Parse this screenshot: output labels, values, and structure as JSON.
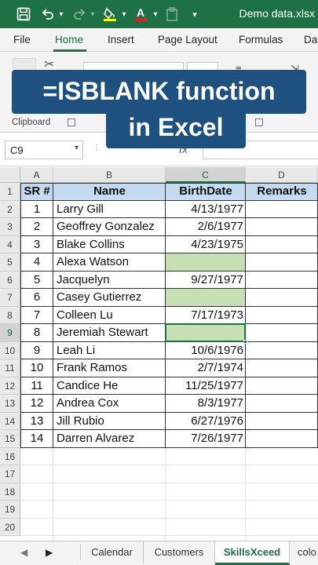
{
  "window": {
    "doc_title": "Demo data.xlsx",
    "qa_icons": [
      "save-icon",
      "undo-icon",
      "redo-icon",
      "fill-color-icon",
      "font-color-icon",
      "clipboard-icon",
      "customize-icon"
    ]
  },
  "ribbon": {
    "tabs": [
      {
        "label": "File",
        "active": false
      },
      {
        "label": "Home",
        "active": true
      },
      {
        "label": "Insert",
        "active": false
      },
      {
        "label": "Page Layout",
        "active": false
      },
      {
        "label": "Formulas",
        "active": false
      },
      {
        "label": "Da",
        "active": false
      }
    ],
    "clipboard_label": "Clipboard",
    "accent_color": "#1e7145"
  },
  "banner": {
    "line1": "=ISBLANK function",
    "line2": "in Excel",
    "bg_color": "#1f5180"
  },
  "formula_bar": {
    "name_box": "C9",
    "fx_label": "fx",
    "content": ""
  },
  "grid": {
    "columns": [
      "A",
      "B",
      "C",
      "D"
    ],
    "selected_column": "C",
    "row_numbers": [
      "1",
      "2",
      "3",
      "4",
      "5",
      "6",
      "7",
      "8",
      "9",
      "10",
      "11",
      "12",
      "13",
      "14",
      "15",
      "16",
      "17",
      "18",
      "19",
      "20"
    ],
    "selected_row": "9",
    "headers": [
      "SR #",
      "Name",
      "BirthDate",
      "Remarks"
    ],
    "header_fill": "#c5d9f1",
    "blank_fill": "#c6dfb4",
    "rows": [
      {
        "sr": "1",
        "name": "Larry Gill",
        "birth": "4/13/1977"
      },
      {
        "sr": "2",
        "name": "Geoffrey Gonzalez",
        "birth": "2/6/1977"
      },
      {
        "sr": "3",
        "name": "Blake Collins",
        "birth": "4/23/1975"
      },
      {
        "sr": "4",
        "name": "Alexa Watson",
        "birth": ""
      },
      {
        "sr": "5",
        "name": "Jacquelyn",
        "birth": "9/27/1977"
      },
      {
        "sr": "6",
        "name": "Casey Gutierrez",
        "birth": ""
      },
      {
        "sr": "7",
        "name": "Colleen Lu",
        "birth": "7/17/1973"
      },
      {
        "sr": "8",
        "name": "Jeremiah Stewart",
        "birth": ""
      },
      {
        "sr": "9",
        "name": "Leah Li",
        "birth": "10/6/1976"
      },
      {
        "sr": "10",
        "name": "Frank Ramos",
        "birth": "2/7/1974"
      },
      {
        "sr": "11",
        "name": "Candice He",
        "birth": "11/25/1977"
      },
      {
        "sr": "12",
        "name": "Andrea Cox",
        "birth": "8/3/1977"
      },
      {
        "sr": "13",
        "name": "Jill Rubio",
        "birth": "6/27/1976"
      },
      {
        "sr": "14",
        "name": "Darren Alvarez",
        "birth": "7/26/1977"
      }
    ]
  },
  "sheets": {
    "tabs": [
      {
        "label": "Calendar",
        "active": false
      },
      {
        "label": "Customers",
        "active": false
      },
      {
        "label": "SkillsXceed",
        "active": true
      },
      {
        "label": "colo",
        "active": false
      }
    ],
    "nav_prev": "◀",
    "nav_next": "▶"
  }
}
